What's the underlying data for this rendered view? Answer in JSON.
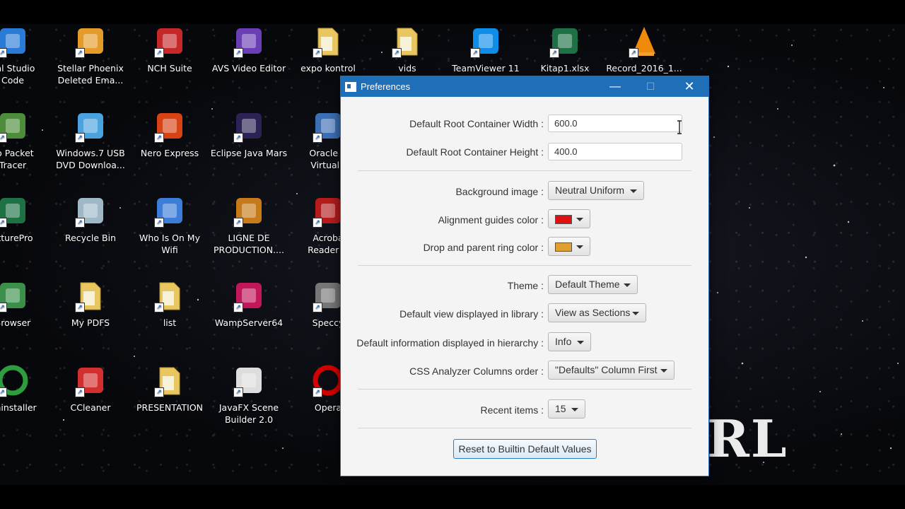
{
  "desktop": {
    "icons": [
      {
        "label": "ual Studio\nCode",
        "icon": "vscode-icon"
      },
      {
        "label": "Stellar Phoenix\nDeleted Ema...",
        "icon": "stellar-phoenix-icon"
      },
      {
        "label": "NCH Suite",
        "icon": "nch-suite-icon"
      },
      {
        "label": "AVS Video Editor",
        "icon": "avs-video-editor-icon"
      },
      {
        "label": "expo kontrol",
        "icon": "folder-icon"
      },
      {
        "label": "vids",
        "icon": "folder-icon"
      },
      {
        "label": "TeamViewer 11",
        "icon": "teamviewer-icon"
      },
      {
        "label": "Kitap1.xlsx",
        "icon": "excel-icon"
      },
      {
        "label": "Record_2016_1...",
        "icon": "vlc-icon"
      },
      {
        "label": "co Packet\nTracer",
        "icon": "packet-tracer-icon"
      },
      {
        "label": "Windows.7 USB\nDVD Downloa...",
        "icon": "windows-usb-icon"
      },
      {
        "label": "Nero Express",
        "icon": "nero-express-icon"
      },
      {
        "label": "Eclipse Java Mars",
        "icon": "eclipse-icon"
      },
      {
        "label": "Oracle V\nVirtualB",
        "icon": "virtualbox-icon"
      },
      {
        "label": "ctturePro",
        "icon": "excel-icon"
      },
      {
        "label": "Recycle Bin",
        "icon": "recycle-bin-icon"
      },
      {
        "label": "Who Is On My\nWifi",
        "icon": "wifi-question-icon"
      },
      {
        "label": "LIGNE DE\nPRODUCTION....",
        "icon": "video-production-icon"
      },
      {
        "label": "Acroba\nReader D",
        "icon": "acrobat-reader-icon"
      },
      {
        "label": "Browser",
        "icon": "browser-icon"
      },
      {
        "label": "My PDFS",
        "icon": "pdf-folder-icon"
      },
      {
        "label": "list",
        "icon": "folder-icon"
      },
      {
        "label": "WampServer64",
        "icon": "wampserver-icon"
      },
      {
        "label": "Speccy",
        "icon": "speccy-icon"
      },
      {
        "label": "Uninstaller",
        "icon": "uninstaller-icon"
      },
      {
        "label": "CCleaner",
        "icon": "ccleaner-icon"
      },
      {
        "label": "PRESENTATION",
        "icon": "folder-icon"
      },
      {
        "label": "JavaFX Scene\nBuilder 2.0",
        "icon": "scene-builder-icon"
      },
      {
        "label": "Opera",
        "icon": "opera-icon"
      }
    ],
    "watermark": "RL"
  },
  "window": {
    "title": "Preferences",
    "controls": {
      "minimize": "—",
      "maximize": "☐",
      "close": "✕"
    }
  },
  "prefs": {
    "root_width_label": "Default Root Container Width :",
    "root_width_value": "600.0",
    "root_height_label": "Default Root Container Height :",
    "root_height_value": "400.0",
    "background_label": "Background image :",
    "background_value": "Neutral Uniform",
    "alignment_label": "Alignment guides color :",
    "alignment_color": "#e01010",
    "ring_label": "Drop and parent ring color :",
    "ring_color": "#e0a030",
    "theme_label": "Theme :",
    "theme_value": "Default Theme",
    "library_view_label": "Default view displayed in library :",
    "library_view_value": "View as Sections",
    "hierarchy_label": "Default information displayed in hierarchy :",
    "hierarchy_value": "Info",
    "css_columns_label": "CSS Analyzer Columns order :",
    "css_columns_value": "\"Defaults\" Column First",
    "recent_label": "Recent items :",
    "recent_value": "15",
    "reset_button": "Reset to Builtin Default Values"
  },
  "colors": {
    "titlebar": "#1f6fb8",
    "window_bg": "#f4f4f4",
    "button_border": "#2b7dc4"
  }
}
